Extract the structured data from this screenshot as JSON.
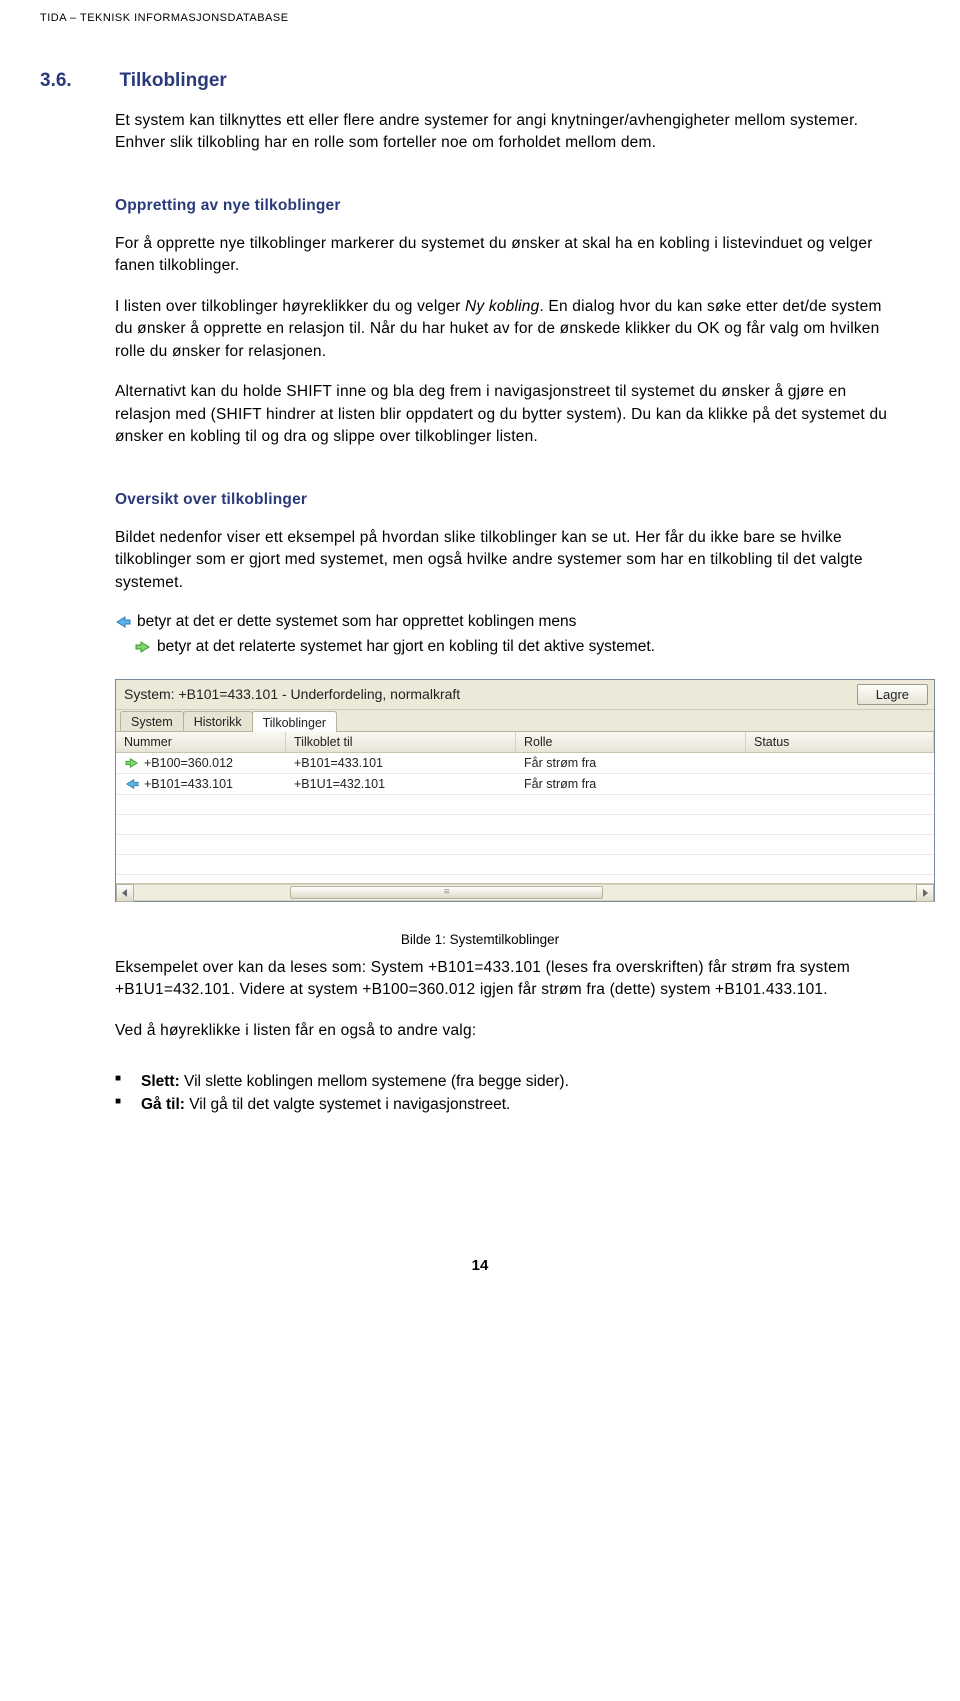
{
  "header": "TIDA – TEKNISK INFORMASJONSDATABASE",
  "section": {
    "num": "3.6.",
    "title": "Tilkoblinger"
  },
  "p1": "Et system kan tilknyttes ett eller flere andre systemer for angi knytninger/avhengigheter mellom systemer. Enhver slik tilkobling har en rolle som forteller noe om forholdet mellom dem.",
  "sub1": "Oppretting av nye tilkoblinger",
  "p2": "For å opprette nye tilkoblinger markerer du systemet du ønsker at skal ha en kobling i listevinduet og velger fanen tilkoblinger.",
  "p3a": "I listen over tilkoblinger høyreklikker du og velger ",
  "p3italic": "Ny kobling",
  "p3b": ". En dialog hvor du kan søke etter det/de system du ønsker å opprette en relasjon til. Når du har huket av for de ønskede klikker du OK og får valg om hvilken rolle du ønsker for relasjonen.",
  "p4": "Alternativt kan du holde SHIFT inne og bla deg frem i navigasjonstreet til systemet du ønsker å gjøre en relasjon med (SHIFT hindrer at listen blir oppdatert og du bytter system). Du kan da klikke på det systemet du ønsker en kobling til og dra og slippe over tilkoblinger listen.",
  "sub2": "Oversikt over tilkoblinger",
  "p5": "Bildet nedenfor viser ett eksempel på hvordan slike tilkoblinger kan se ut. Her får du ikke bare se hvilke tilkoblinger som er gjort med systemet, men også hvilke andre systemer som har en tilkobling til det valgte systemet.",
  "arrow_left_text": "betyr at det er dette systemet som har opprettet koblingen mens",
  "arrow_right_text": "betyr at det relaterte systemet har gjort en kobling til det aktive systemet.",
  "app": {
    "title": "System: +B101=433.101 - Underfordeling, normalkraft",
    "lagre": "Lagre",
    "tabs": [
      "System",
      "Historikk",
      "Tilkoblinger"
    ],
    "active_tab": 2,
    "columns": {
      "nummer": "Nummer",
      "tilkoblet": "Tilkoblet til",
      "rolle": "Rolle",
      "status": "Status"
    },
    "rows": [
      {
        "dir": "right",
        "nummer": "+B100=360.012",
        "tilkoblet": "+B101=433.101",
        "rolle": "Får strøm fra",
        "status": ""
      },
      {
        "dir": "left",
        "nummer": "+B101=433.101",
        "tilkoblet": "+B1U1=432.101",
        "rolle": "Får strøm fra",
        "status": ""
      }
    ]
  },
  "caption": "Bilde 1: Systemtilkoblinger",
  "p6": "Eksempelet over kan da leses som: System +B101=433.101 (leses fra overskriften) får strøm fra system +B1U1=432.101. Videre at system +B100=360.012 igjen får strøm fra (dette) system +B101.433.101.",
  "p7": "Ved å høyreklikke i listen får en også to andre valg:",
  "bullets": [
    {
      "label": "Slett:",
      "text": " Vil slette koblingen mellom systemene (fra begge sider)."
    },
    {
      "label": "Gå til:",
      "text": " Vil gå til det valgte systemet i navigasjonstreet."
    }
  ],
  "page_num": "14"
}
